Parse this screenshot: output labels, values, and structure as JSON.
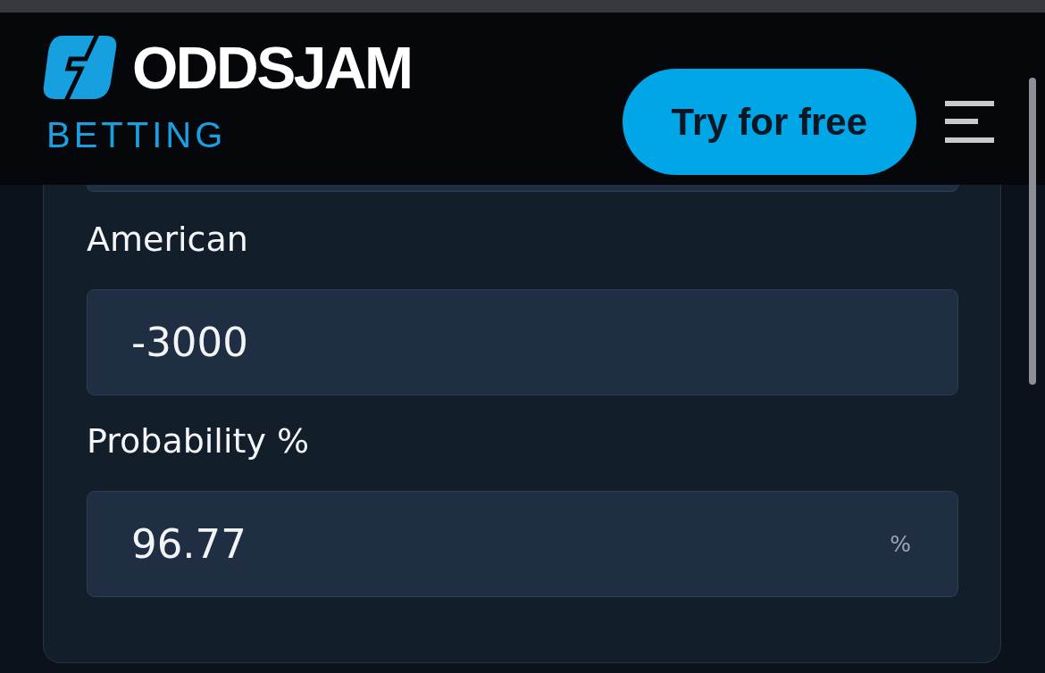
{
  "header": {
    "logo": {
      "wordmark": "ODDSJAM",
      "tagline": "BETTING"
    },
    "cta_button": "Try for free"
  },
  "converter": {
    "fields": [
      {
        "kind": "clipped"
      },
      {
        "kind": "input",
        "label": "American",
        "value": "-3000"
      },
      {
        "kind": "input",
        "label": "Probability %",
        "value": "96.77",
        "suffix": "%"
      }
    ]
  }
}
